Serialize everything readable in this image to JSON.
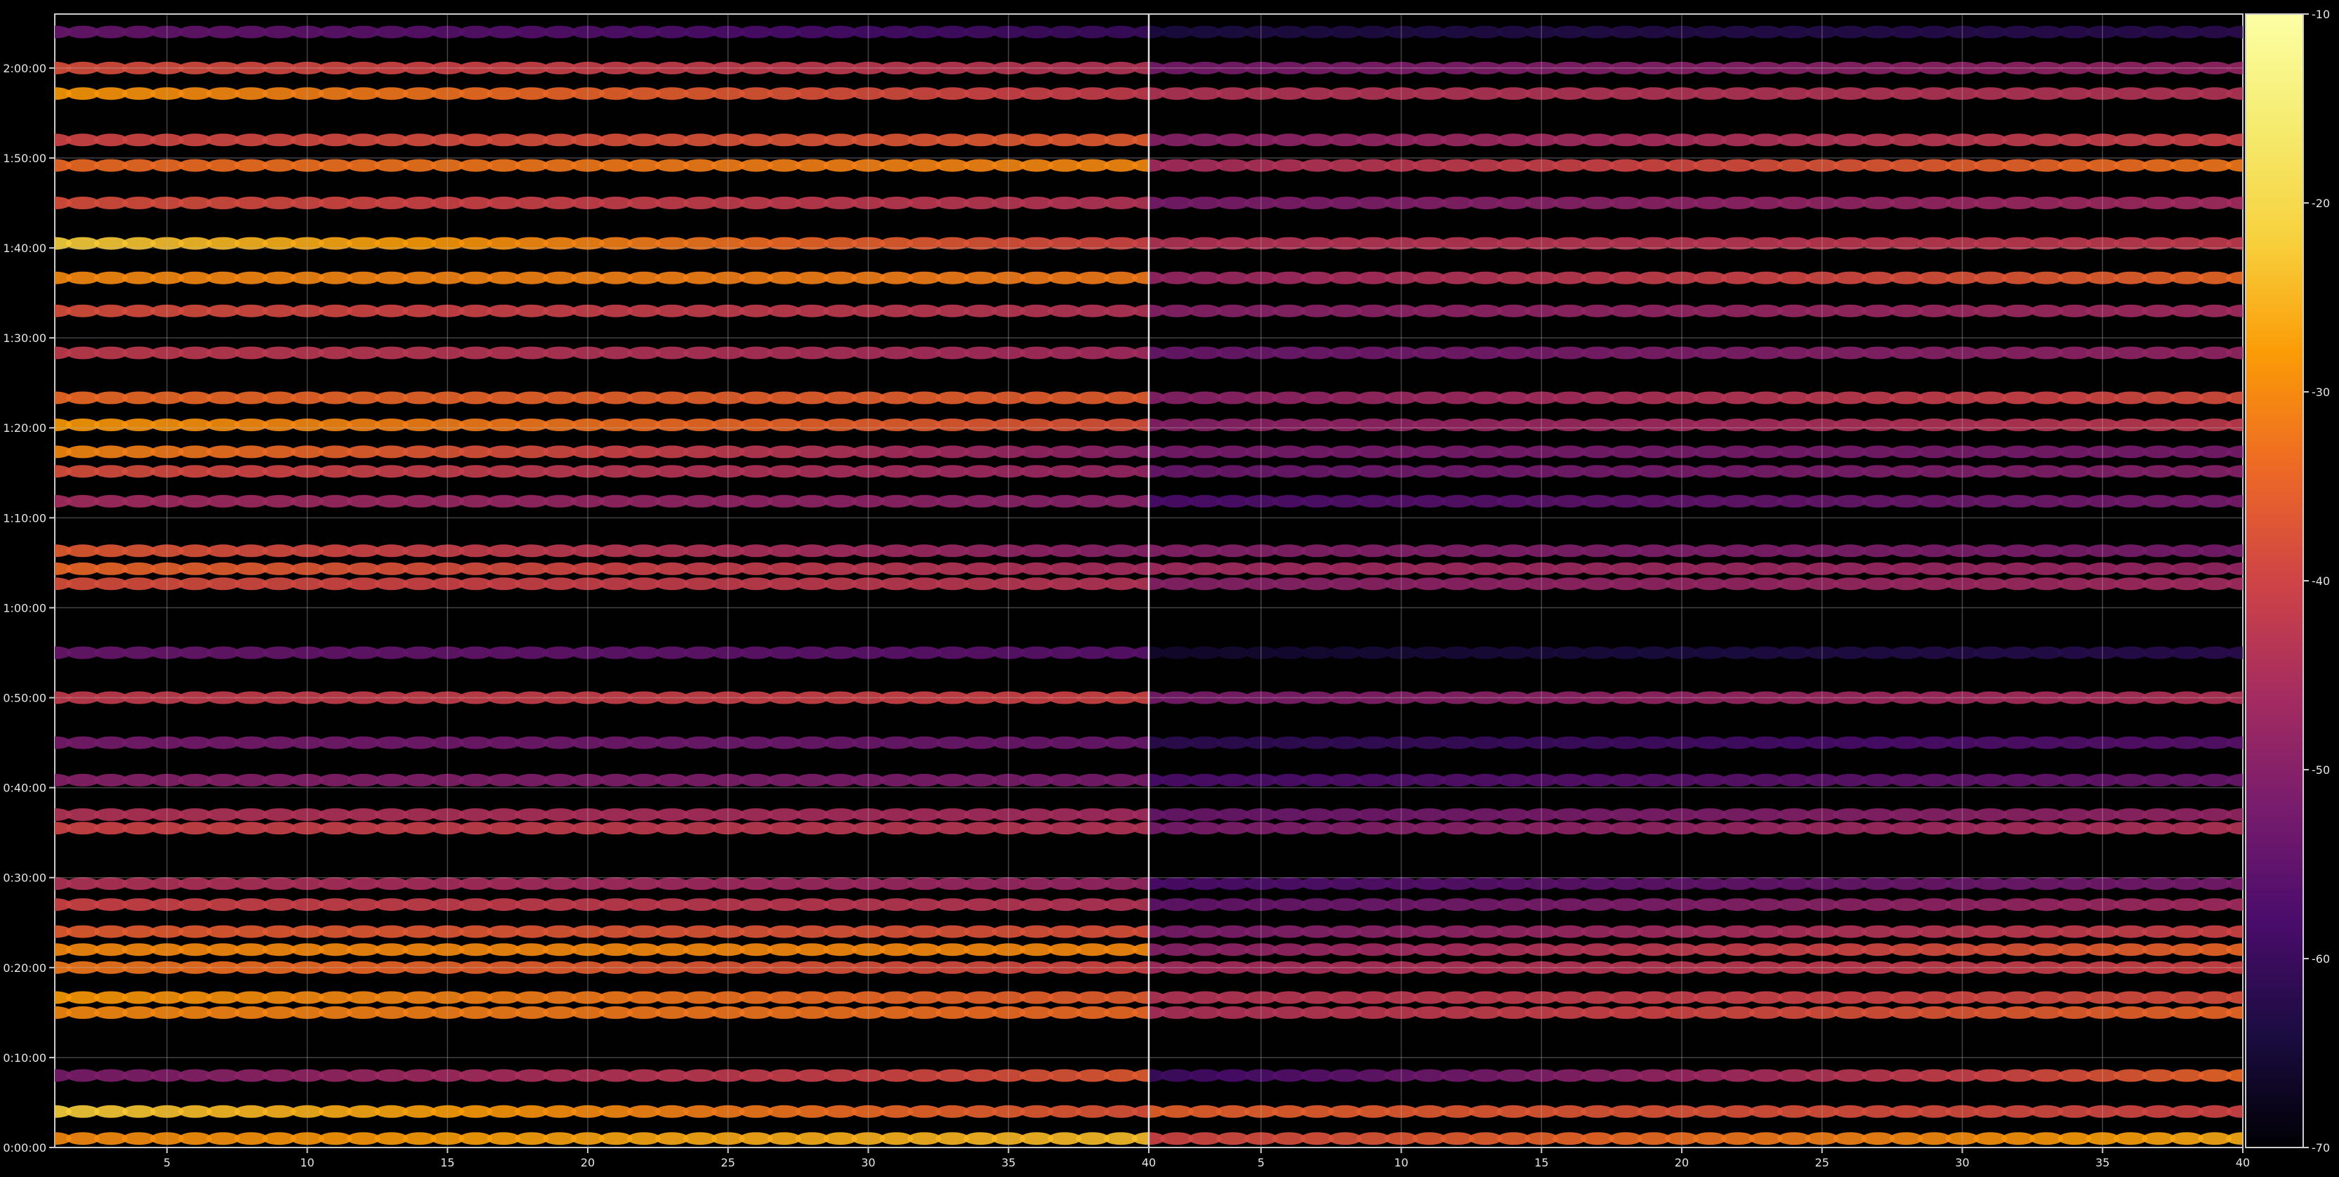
{
  "chart_data": {
    "type": "heatmap",
    "title": "",
    "xlabel": "",
    "ylabel": "",
    "panels": [
      {
        "name": "",
        "x_range": [
          1,
          40
        ],
        "x_ticks": [
          5,
          10,
          15,
          20,
          25,
          30,
          35,
          40
        ]
      },
      {
        "name": "",
        "x_range": [
          1,
          40
        ],
        "x_ticks": [
          5,
          10,
          15,
          20,
          25,
          30,
          35,
          40
        ]
      }
    ],
    "y_range_seconds": [
      0,
      7560
    ],
    "y_ticks": [
      {
        "value": 0,
        "label": "0:00:00"
      },
      {
        "value": 600,
        "label": "0:10:00"
      },
      {
        "value": 1200,
        "label": "0:20:00"
      },
      {
        "value": 1800,
        "label": "0:30:00"
      },
      {
        "value": 2400,
        "label": "0:40:00"
      },
      {
        "value": 3000,
        "label": "0:50:00"
      },
      {
        "value": 3600,
        "label": "1:00:00"
      },
      {
        "value": 4200,
        "label": "1:10:00"
      },
      {
        "value": 4800,
        "label": "1:20:00"
      },
      {
        "value": 5400,
        "label": "1:30:00"
      },
      {
        "value": 6000,
        "label": "1:40:00"
      },
      {
        "value": 6600,
        "label": "1:50:00"
      },
      {
        "value": 7200,
        "label": "2:00:00"
      }
    ],
    "colorbar": {
      "colormap": "inferno",
      "range": [
        -70,
        -10
      ],
      "ticks": [
        {
          "value": -10,
          "label": "-10"
        },
        {
          "value": -20,
          "label": "-20"
        },
        {
          "value": -30,
          "label": "-30"
        },
        {
          "value": -40,
          "label": "-40"
        },
        {
          "value": -50,
          "label": "-50"
        },
        {
          "value": -60,
          "label": "-60"
        },
        {
          "value": -70,
          "label": "-70"
        }
      ]
    },
    "bands": [
      {
        "t": 60,
        "left_start": -30,
        "left_end": -24,
        "right_start": -40,
        "right_end": -26
      },
      {
        "t": 240,
        "left_start": -22,
        "left_end": -38,
        "right_start": -35,
        "right_end": -40
      },
      {
        "t": 480,
        "left_start": -52,
        "left_end": -36,
        "right_start": -60,
        "right_end": -34
      },
      {
        "t": 900,
        "left_start": -30,
        "left_end": -34,
        "right_start": -45,
        "right_end": -34
      },
      {
        "t": 1000,
        "left_start": -28,
        "left_end": -36,
        "right_start": -44,
        "right_end": -38
      },
      {
        "t": 1200,
        "left_start": -32,
        "left_end": -40,
        "right_start": -46,
        "right_end": -40
      },
      {
        "t": 1320,
        "left_start": -30,
        "left_end": -30,
        "right_start": -50,
        "right_end": -34
      },
      {
        "t": 1440,
        "left_start": -36,
        "left_end": -38,
        "right_start": -52,
        "right_end": -40
      },
      {
        "t": 1620,
        "left_start": -40,
        "left_end": -44,
        "right_start": -55,
        "right_end": -46
      },
      {
        "t": 1760,
        "left_start": -44,
        "left_end": -48,
        "right_start": -58,
        "right_end": -52
      },
      {
        "t": 2130,
        "left_start": -40,
        "left_end": -44,
        "right_start": -52,
        "right_end": -44
      },
      {
        "t": 2220,
        "left_start": -44,
        "left_end": -46,
        "right_start": -54,
        "right_end": -48
      },
      {
        "t": 2450,
        "left_start": -50,
        "left_end": -52,
        "right_start": -58,
        "right_end": -54
      },
      {
        "t": 2700,
        "left_start": -52,
        "left_end": -54,
        "right_start": -62,
        "right_end": -56
      },
      {
        "t": 3000,
        "left_start": -42,
        "left_end": -40,
        "right_start": -52,
        "right_end": -44
      },
      {
        "t": 3300,
        "left_start": -54,
        "left_end": -56,
        "right_start": -66,
        "right_end": -62
      },
      {
        "t": 3760,
        "left_start": -38,
        "left_end": -44,
        "right_start": -50,
        "right_end": -46
      },
      {
        "t": 3860,
        "left_start": -34,
        "left_end": -46,
        "right_start": -46,
        "right_end": -48
      },
      {
        "t": 3980,
        "left_start": -36,
        "left_end": -50,
        "right_start": -50,
        "right_end": -52
      },
      {
        "t": 4310,
        "left_start": -46,
        "left_end": -50,
        "right_start": -58,
        "right_end": -52
      },
      {
        "t": 4510,
        "left_start": -38,
        "left_end": -48,
        "right_start": -54,
        "right_end": -50
      },
      {
        "t": 4640,
        "left_start": -30,
        "left_end": -50,
        "right_start": -52,
        "right_end": -52
      },
      {
        "t": 4820,
        "left_start": -28,
        "left_end": -38,
        "right_start": -50,
        "right_end": -42
      },
      {
        "t": 5000,
        "left_start": -34,
        "left_end": -36,
        "right_start": -50,
        "right_end": -38
      },
      {
        "t": 5300,
        "left_start": -42,
        "left_end": -46,
        "right_start": -54,
        "right_end": -48
      },
      {
        "t": 5580,
        "left_start": -38,
        "left_end": -44,
        "right_start": -50,
        "right_end": -46
      },
      {
        "t": 5800,
        "left_start": -30,
        "left_end": -32,
        "right_start": -48,
        "right_end": -34
      },
      {
        "t": 6030,
        "left_start": -22,
        "left_end": -40,
        "right_start": -44,
        "right_end": -42
      },
      {
        "t": 6300,
        "left_start": -38,
        "left_end": -44,
        "right_start": -52,
        "right_end": -46
      },
      {
        "t": 6550,
        "left_start": -34,
        "left_end": -30,
        "right_start": -46,
        "right_end": -32
      },
      {
        "t": 6720,
        "left_start": -40,
        "left_end": -36,
        "right_start": -50,
        "right_end": -40
      },
      {
        "t": 7030,
        "left_start": -28,
        "left_end": -42,
        "right_start": -44,
        "right_end": -44
      },
      {
        "t": 7200,
        "left_start": -38,
        "left_end": -44,
        "right_start": -52,
        "right_end": -48
      },
      {
        "t": 7440,
        "left_start": -54,
        "left_end": -60,
        "right_start": -64,
        "right_end": -62
      }
    ]
  }
}
